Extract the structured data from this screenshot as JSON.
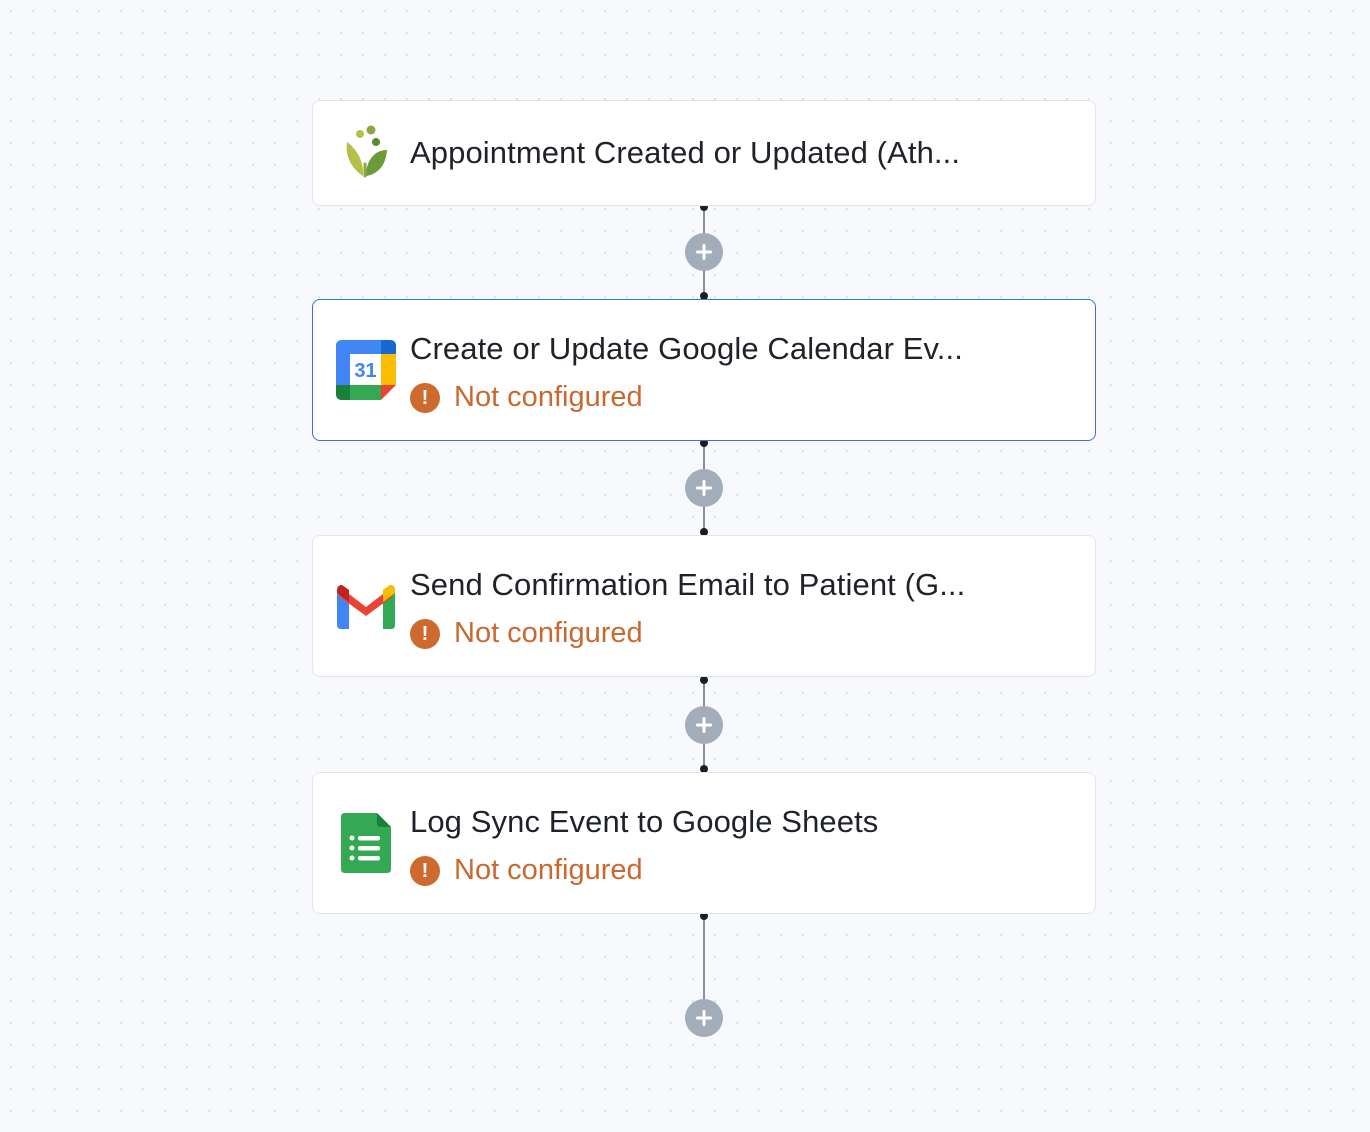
{
  "workflow": {
    "nodes": [
      {
        "title": "Appointment Created or Updated (Ath...",
        "icon": "athenahealth-leaf-icon",
        "status": "",
        "selected": false
      },
      {
        "title": "Create or Update Google Calendar Ev...",
        "icon": "google-calendar-icon",
        "icon_text": "31",
        "status": "Not configured",
        "selected": true
      },
      {
        "title": "Send Confirmation Email to Patient (G...",
        "icon": "gmail-icon",
        "status": "Not configured",
        "selected": false
      },
      {
        "title": "Log Sync Event to Google Sheets",
        "icon": "google-sheets-icon",
        "status": "Not configured",
        "selected": false
      }
    ],
    "warning_glyph": "!",
    "add_step_glyph": "+"
  },
  "colors": {
    "canvas_background": "#f8f9fc",
    "selected_border": "#3b6fd8",
    "warning": "#cf6a2f",
    "add_button": "#a3acba"
  }
}
